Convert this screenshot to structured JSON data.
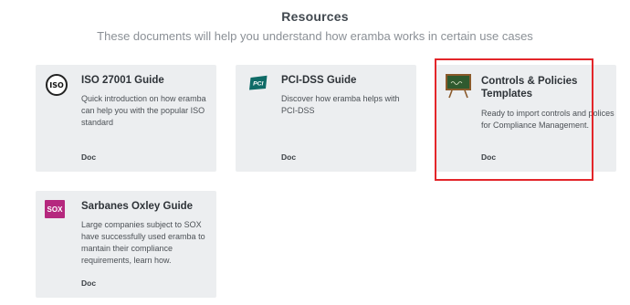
{
  "header": {
    "title": "Resources",
    "subtitle": "These documents will help you understand how eramba works in certain use cases"
  },
  "cards": [
    {
      "id": "iso",
      "title": "ISO 27001 Guide",
      "description": "Quick introduction on how eramba can help you with the popular ISO standard",
      "type": "Doc",
      "logo_text": "ISO"
    },
    {
      "id": "pci",
      "title": "PCI-DSS Guide",
      "description": "Discover how eramba helps with PCI-DSS",
      "type": "Doc",
      "logo_text": "PCI"
    },
    {
      "id": "ctrl",
      "title": "Controls & Policies Templates",
      "description": "Ready to import controls and polices for Compliance Management.",
      "type": "Doc",
      "logo_icon": "chalkboard-icon"
    },
    {
      "id": "sox",
      "title": "Sarbanes Oxley Guide",
      "description": "Large companies subject to SOX have successfully used eramba to mantain their compliance requirements, learn how.",
      "type": "Doc",
      "logo_text": "SOX"
    }
  ],
  "colors": {
    "card_background": "#eceef0",
    "highlight_border": "#e3262a",
    "pci_logo": "#0f6b67",
    "sox_logo": "#b5287e",
    "chalkboard": "#2f5a2f"
  }
}
